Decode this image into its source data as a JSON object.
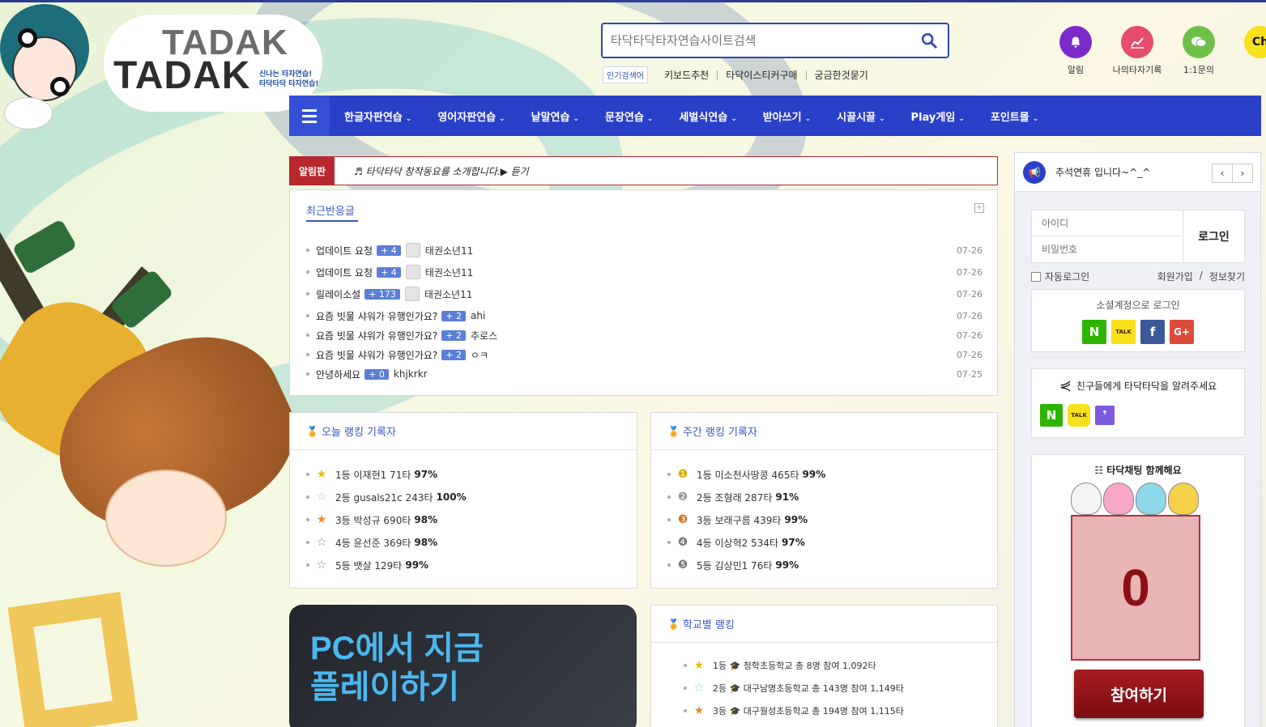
{
  "colors": {
    "brand_blue": "#2b40c8",
    "notice_red": "#b7282e",
    "count_badge": "#5b7fd6"
  },
  "logo": {
    "line1": "TADAK",
    "line2": "TADAK",
    "sub1": "신나는 타자연습!",
    "sub2": "타닥타닥 타자연습!"
  },
  "search": {
    "placeholder": "타닥타닥타자연습사이트검색",
    "icon": "search-icon"
  },
  "popular": {
    "tag": "인기검색어",
    "keywords": [
      "키보드추천",
      "타닥이스티커구매",
      "궁금한것묻기"
    ]
  },
  "top_icons": [
    {
      "label": "알림",
      "icon": "bell-icon",
      "color": "#7b2bc9"
    },
    {
      "label": "나의타자기록",
      "icon": "chart-icon",
      "color": "#e44d6c"
    },
    {
      "label": "1:1문의",
      "icon": "chat-icon",
      "color": "#6fc04a"
    },
    {
      "label": "Ch",
      "icon": "kakao-channel-icon",
      "color": "#f7e11b"
    }
  ],
  "nav": [
    "한글자판연습",
    "영어자판연습",
    "낱말연습",
    "문장연습",
    "세벌식연습",
    "받아쓰기",
    "시끌시끌",
    "Play게임",
    "포인트몰"
  ],
  "notice": {
    "label": "알림판",
    "text": "♬ 타닥타닥 창작동요를 소개합니다.▶ 듣기"
  },
  "recent": {
    "title": "최근반응글",
    "rows": [
      {
        "title": "업데이트 요청",
        "count": "+ 4",
        "nick": "태권소년11",
        "date": "07-26",
        "avatar": true
      },
      {
        "title": "업데이트 요청",
        "count": "+ 4",
        "nick": "태권소년11",
        "date": "07-26",
        "avatar": true
      },
      {
        "title": "릴레이소설",
        "count": "+ 173",
        "nick": "태권소년11",
        "date": "07-26",
        "avatar": true
      },
      {
        "title": "요즘 빗물 샤워가 유행인가요?",
        "count": "+ 2",
        "nick": "ahi",
        "date": "07-26",
        "avatar": false
      },
      {
        "title": "요즘 빗물 샤워가 유행인가요?",
        "count": "+ 2",
        "nick": "추로스",
        "date": "07-26",
        "avatar": false
      },
      {
        "title": "요즘 빗물 샤워가 유행인가요?",
        "count": "+ 2",
        "nick": "ㅇㅋ",
        "date": "07-26",
        "avatar": false
      },
      {
        "title": "안녕하세요",
        "count": "+ 0",
        "nick": "khjkrkr",
        "date": "07-25",
        "avatar": false
      }
    ]
  },
  "today_rank": {
    "title": "오늘 랭킹 기록자",
    "rows": [
      {
        "text": "1등 이재현1 71타",
        "pct": "97%",
        "icon": "gold-star-icon"
      },
      {
        "text": "2등 gusals21c 243타",
        "pct": "100%",
        "icon": "silver-star-icon"
      },
      {
        "text": "3등 박성규 690타",
        "pct": "98%",
        "icon": "bronze-star-icon"
      },
      {
        "text": "4등 윤선준 369타",
        "pct": "98%",
        "icon": "grey-star-icon"
      },
      {
        "text": "5등 뱃살 129타",
        "pct": "99%",
        "icon": "grey-star-icon"
      }
    ]
  },
  "week_rank": {
    "title": "주간 랭킹 기록자",
    "rows": [
      {
        "text": "1등 미소천사땅콩 465타",
        "pct": "99%",
        "icon": "gold-medal-icon"
      },
      {
        "text": "2등 조형래 287타",
        "pct": "91%",
        "icon": "silver-medal-icon"
      },
      {
        "text": "3등 보래구름 439타",
        "pct": "99%",
        "icon": "bronze-medal-icon"
      },
      {
        "text": "4등 이상혁2 534타",
        "pct": "97%",
        "icon": "rank4-icon"
      },
      {
        "text": "5등 김상민1 76타",
        "pct": "99%",
        "icon": "rank5-icon"
      }
    ]
  },
  "promo": {
    "line1": "PC에서 지금",
    "line2": "플레이하기"
  },
  "school_rank": {
    "title": "학교별 랭킹",
    "rows": [
      {
        "text": "1등 🎓 청학초등학교 총 8명 참여 1,092타"
      },
      {
        "text": "2등 🎓 대구남명초등학교 총 143명 참여 1,149타"
      },
      {
        "text": "3등 🎓 대구월성초등학교 총 194명 참여 1,115타"
      }
    ]
  },
  "side_notice": {
    "text": "추석연휴 입니다~^_^",
    "prev": "‹",
    "next": "›"
  },
  "login": {
    "id_placeholder": "아이디",
    "pw_placeholder": "비밀번호",
    "button": "로그인",
    "auto": "자동로그인",
    "join": "회원가입",
    "sep": "/",
    "find": "정보찾기"
  },
  "social": {
    "title": "소셜계정으로 로그인",
    "buttons": [
      "N",
      "TALK",
      "f",
      "G+"
    ]
  },
  "share": {
    "title": "친구들에게 타닥타닥을 알려주세요",
    "buttons": [
      "N",
      "TALK",
      "❜"
    ]
  },
  "chat": {
    "title": "☷ 타닥채팅 함께해요",
    "count": "0",
    "join": "참여하기"
  }
}
